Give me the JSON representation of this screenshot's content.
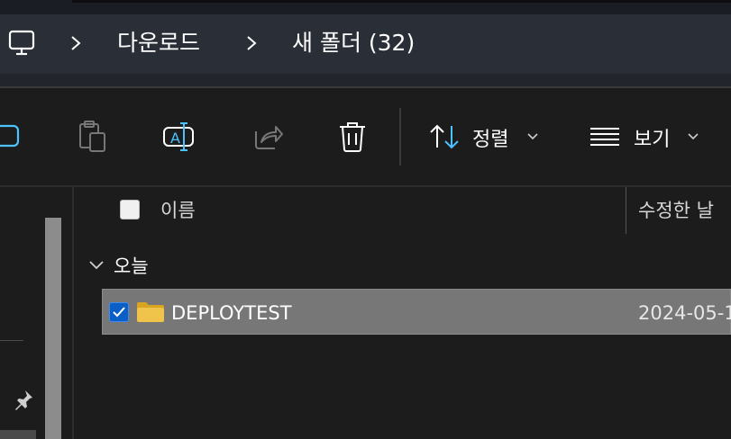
{
  "breadcrumb": {
    "items": [
      "다운로드",
      "새 폴더 (32)"
    ]
  },
  "toolbar": {
    "sort_label": "정렬",
    "view_label": "보기"
  },
  "list": {
    "columns": {
      "name": "이름",
      "date": "수정한 날"
    },
    "groups": [
      {
        "label": "오늘",
        "rows": [
          {
            "name": "DEPLOYTEST",
            "date": "2024-05-1",
            "selected": true
          }
        ]
      }
    ]
  },
  "colors": {
    "accent": "#0a5fc7",
    "folder": "#f0c34a",
    "selection": "#777777"
  }
}
